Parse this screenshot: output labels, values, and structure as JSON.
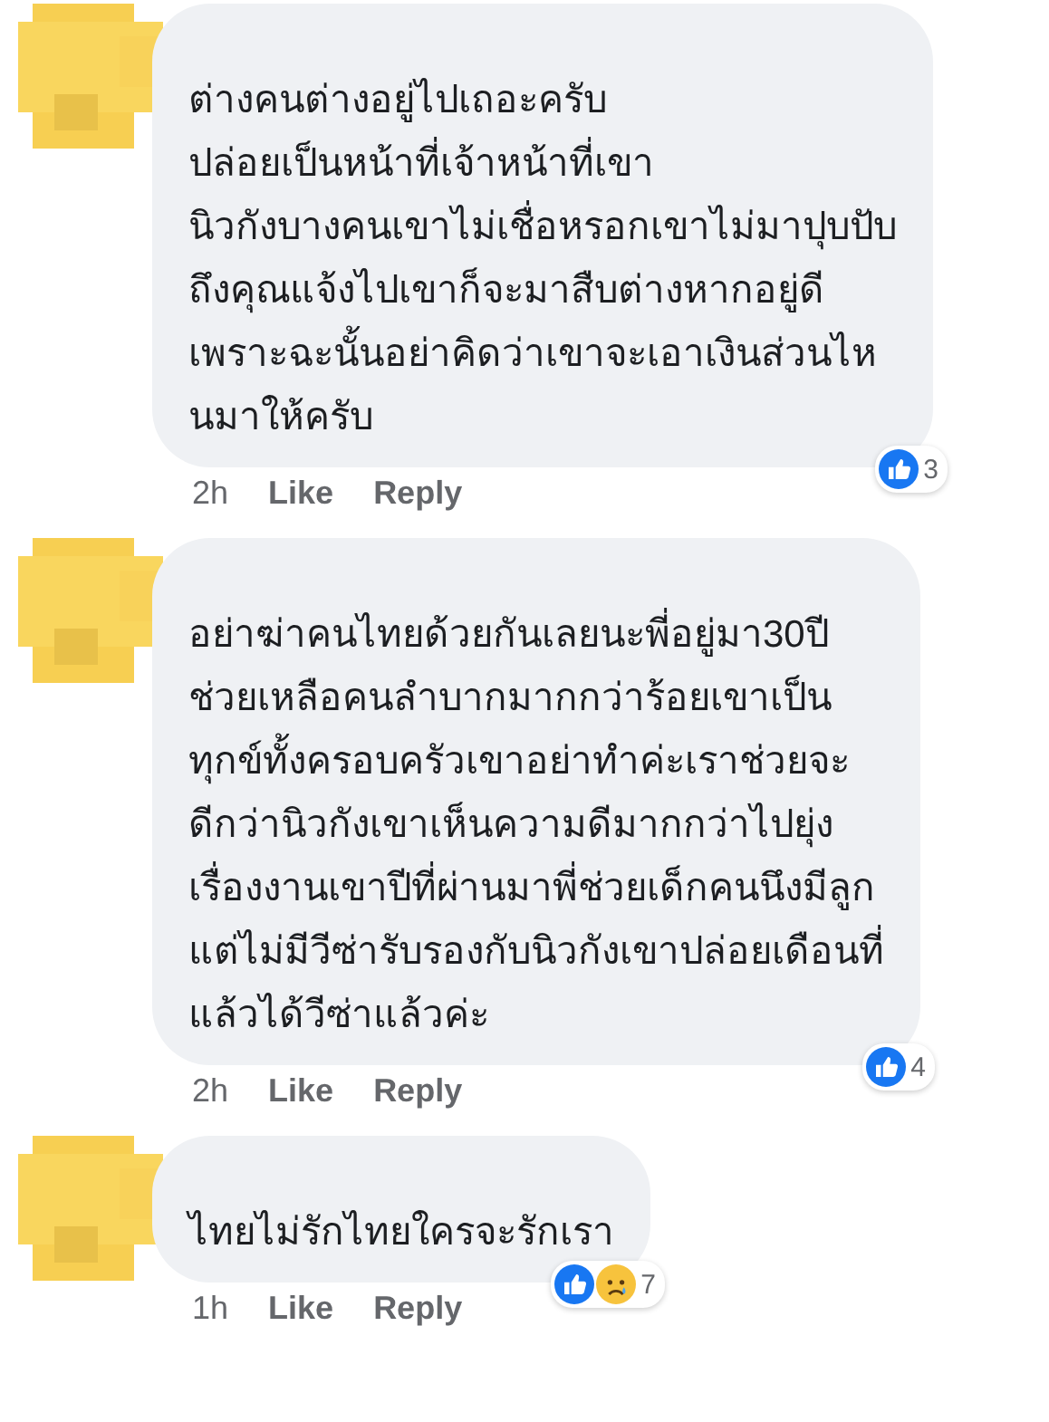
{
  "comments": [
    {
      "text": "ต่างคนต่างอยู่ไปเถอะครับ\nปล่อยเป็นหน้าที่เจ้าหน้าที่เขา\nนิวกังบางคนเขาไม่เชื่อหรอกเขาไม่มาปุบปับ\nถึงคุณแจ้งไปเขาก็จะมาสืบต่างหากอยู่ดี\nเพราะฉะนั้นอย่าคิดว่าเขาจะเอาเงินส่วนไห\nนมาให้ครับ",
      "time": "2h",
      "like": "Like",
      "reply": "Reply",
      "reactions": [
        {
          "kind": "like"
        }
      ],
      "reaction_count": "3"
    },
    {
      "text": "อย่าฆ่าคนไทยด้วยกันเลยนะพี่อยู่มา30ปี\nช่วยเหลือคนลำบากมากกว่าร้อยเขาเป็น\nทุกข์ทั้งครอบครัวเขาอย่าทำค่ะเราช่วยจะ\nดีกว่านิวกังเขาเห็นความดีมากกว่าไปยุ่ง\nเรื่องงานเขาปีที่ผ่านมาพี่ช่วยเด็กคนนึงมีลูก\nแต่ไม่มีวีซ่ารับรองกับนิวกังเขาปล่อยเดือนที่\nแล้วได้วีซ่าแล้วค่ะ",
      "time": "2h",
      "like": "Like",
      "reply": "Reply",
      "reactions": [
        {
          "kind": "like"
        }
      ],
      "reaction_count": "4"
    },
    {
      "text": "ไทยไม่รักไทยใครจะรักเรา",
      "time": "1h",
      "like": "Like",
      "reply": "Reply",
      "reactions": [
        {
          "kind": "like"
        },
        {
          "kind": "sad"
        }
      ],
      "reaction_count": "7"
    }
  ]
}
